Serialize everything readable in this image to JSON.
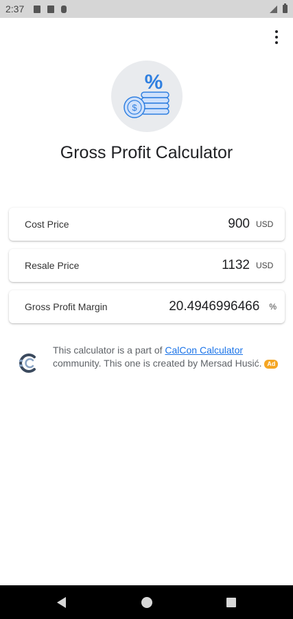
{
  "status_bar": {
    "time": "2:37"
  },
  "header": {
    "title": "Gross Profit Calculator"
  },
  "logo": {
    "symbol": "%",
    "coin_symbol": "$"
  },
  "fields": [
    {
      "label": "Cost Price",
      "value": "900",
      "unit": "USD"
    },
    {
      "label": "Resale Price",
      "value": "1132",
      "unit": "USD"
    },
    {
      "label": "Gross Profit Margin",
      "value": "20.4946996466",
      "unit": "%"
    }
  ],
  "community": {
    "text_before": "This calculator is a part of ",
    "link_text": "CalCon Calculator",
    "text_after": " community. This one is created by Mersad Husić. ",
    "badge": "Ad"
  },
  "colors": {
    "accent": "#1a73e8",
    "badge": "#f5a623",
    "logo_blue": "#2f7fe0"
  },
  "icons": [
    "overflow-menu-icon",
    "percent-coins-icon",
    "calcon-logo-icon",
    "back-icon",
    "home-icon",
    "recents-icon"
  ]
}
